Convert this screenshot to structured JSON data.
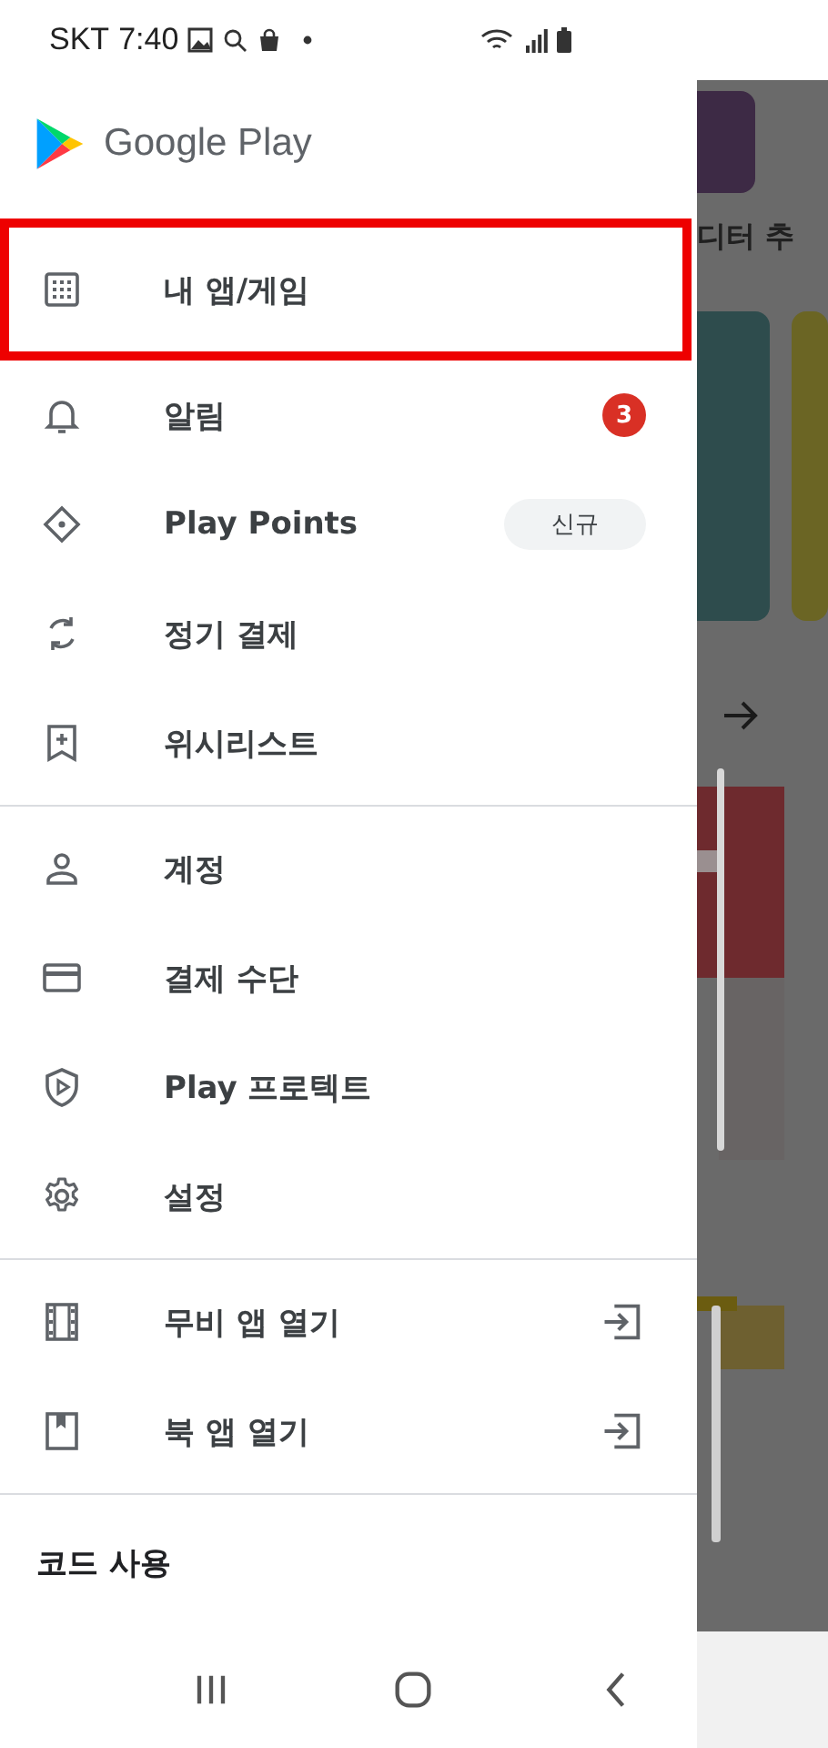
{
  "status_bar": {
    "carrier": "SKT",
    "time": "7:40"
  },
  "header": {
    "title": "Google Play"
  },
  "sections": [
    {
      "items": [
        {
          "label": "내 앱/게임",
          "highlighted": true
        },
        {
          "label": "알림",
          "highlighted": false,
          "badge": "3"
        },
        {
          "label": "Play Points",
          "highlighted": false,
          "tag": "신규"
        },
        {
          "label": "정기 결제",
          "highlighted": false
        },
        {
          "label": "위시리스트",
          "highlighted": false
        }
      ]
    },
    {
      "items": [
        {
          "label": "계정",
          "highlighted": false
        },
        {
          "label": "결제 수단",
          "highlighted": false
        },
        {
          "label": "Play 프로텍트",
          "highlighted": false
        },
        {
          "label": "설정",
          "highlighted": false
        }
      ]
    },
    {
      "items": [
        {
          "label": "무비 앱 열기",
          "highlighted": false,
          "external": true
        },
        {
          "label": "북 앱 열기",
          "highlighted": false,
          "external": true
        }
      ]
    }
  ],
  "footer_links": [
    "코드 사용"
  ],
  "background": {
    "heading": "디터 추"
  }
}
